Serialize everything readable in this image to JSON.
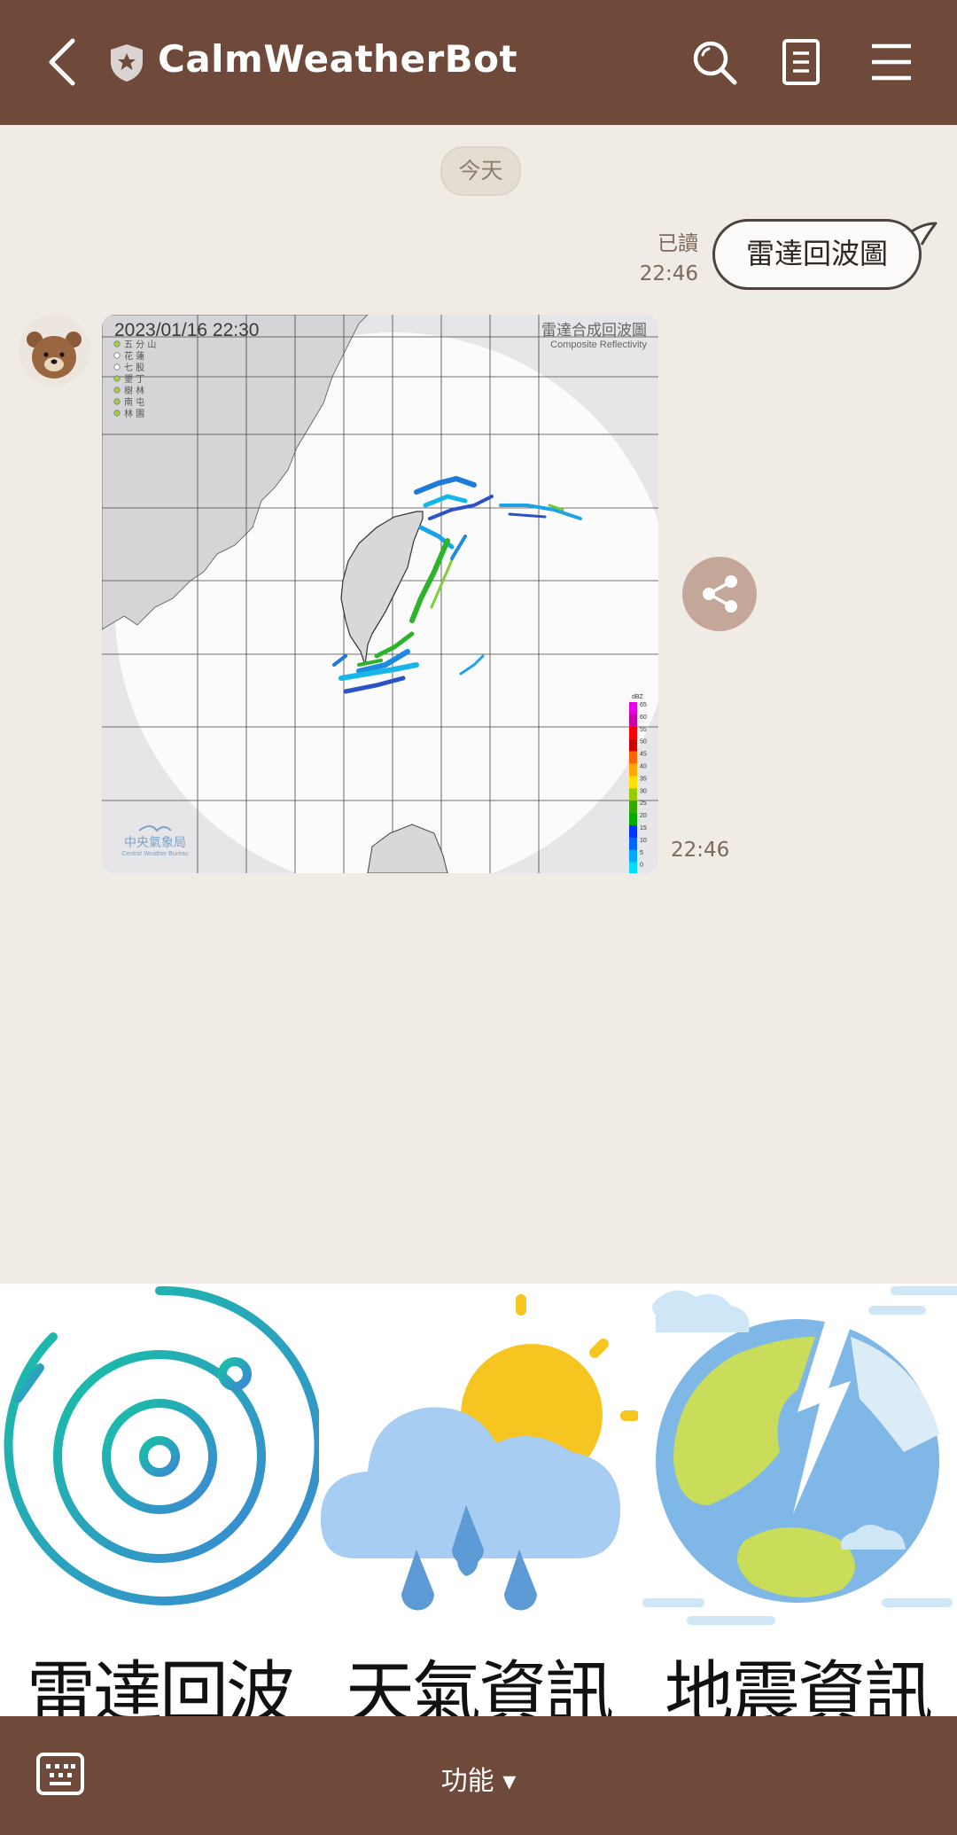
{
  "header": {
    "title": "CalmWeatherBot",
    "icons": [
      "back-icon",
      "shield-icon",
      "search-icon",
      "notes-icon",
      "menu-icon"
    ]
  },
  "chat": {
    "date_label": "今天",
    "outgoing": {
      "read_status": "已讀",
      "time": "22:46",
      "text": "雷達回波圖"
    },
    "incoming": {
      "time": "22:46",
      "image": {
        "timestamp": "2023/01/16  22:30",
        "title_zh": "雷達合成回波圖",
        "title_en": "Composite Reflectivity",
        "stations": [
          "五 分 山",
          "花    蓮",
          "七    股",
          "墾    丁",
          "樹    林",
          "南    屯",
          "林    園"
        ],
        "agency_zh": "中央氣象局",
        "agency_en": "Central Weather Bureau",
        "scale_unit": "dBZ",
        "scale_values": [
          "65",
          "60",
          "55",
          "50",
          "45",
          "40",
          "35",
          "30",
          "25",
          "20",
          "15",
          "10",
          "5",
          "0"
        ]
      }
    }
  },
  "rich_menu": {
    "items": [
      {
        "label": "雷達回波",
        "icon": "radar-icon"
      },
      {
        "label": "天氣資訊",
        "icon": "weather-icon"
      },
      {
        "label": "地震資訊",
        "icon": "earthquake-icon"
      }
    ]
  },
  "footer": {
    "menu_label": "功能 ▾"
  },
  "colors": {
    "bar": "#6f4a3a",
    "background": "#f0ebe5",
    "share": "#c5a799"
  }
}
